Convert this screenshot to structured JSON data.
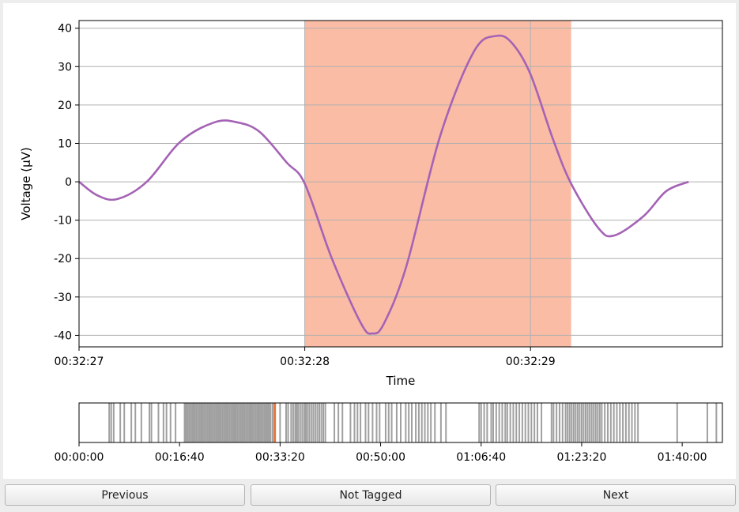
{
  "buttons": {
    "previous": "Previous",
    "tag_status": "Not Tagged",
    "next": "Next"
  },
  "chart_data": [
    {
      "type": "line",
      "xlabel": "Time",
      "ylabel": "Voltage (μV)",
      "xlim": [
        0,
        2.85
      ],
      "ylim": [
        -43,
        42
      ],
      "x_ticks": [
        {
          "value": 0.0,
          "label": "00:32:27"
        },
        {
          "value": 1.0,
          "label": "00:32:28"
        },
        {
          "value": 2.0,
          "label": "00:32:29"
        }
      ],
      "y_ticks": [
        40,
        30,
        20,
        10,
        0,
        -10,
        -20,
        -30,
        -40
      ],
      "grid": true,
      "line_color": "#a463b5",
      "highlight": {
        "x_start": 1.0,
        "x_end": 2.18,
        "color": "#fbbca5"
      },
      "series": [
        {
          "x": [
            0.0,
            0.08,
            0.17,
            0.3,
            0.45,
            0.6,
            0.7,
            0.8,
            0.92,
            1.0,
            1.12,
            1.25,
            1.3,
            1.35,
            1.45,
            1.6,
            1.75,
            1.85,
            1.92,
            2.0,
            2.1,
            2.18,
            2.3,
            2.37,
            2.5,
            2.6,
            2.7
          ],
          "y": [
            0,
            -3.5,
            -4.5,
            0,
            10.5,
            15.5,
            15.5,
            13,
            5,
            -0.5,
            -20,
            -37,
            -39.5,
            -37,
            -22,
            12,
            34,
            38,
            36,
            28,
            11,
            -0.5,
            -12,
            -14,
            -9,
            -2.5,
            0
          ]
        }
      ]
    },
    {
      "type": "event-raster",
      "xlim": [
        0,
        6400
      ],
      "x_ticks": [
        {
          "value": 0,
          "label": "00:00:00"
        },
        {
          "value": 1000,
          "label": "00:16:40"
        },
        {
          "value": 2000,
          "label": "00:33:20"
        },
        {
          "value": 3000,
          "label": "00:50:00"
        },
        {
          "value": 4000,
          "label": "01:06:40"
        },
        {
          "value": 5000,
          "label": "01:23:20"
        },
        {
          "value": 6000,
          "label": "01:40:00"
        }
      ],
      "event_color": "#a0a0a0",
      "current_color": "#e8743b",
      "current_event": 1947,
      "events": [
        300,
        320,
        345,
        410,
        450,
        520,
        560,
        620,
        700,
        720,
        790,
        840,
        870,
        910,
        960,
        1050,
        1065,
        1080,
        1095,
        1110,
        1125,
        1140,
        1155,
        1170,
        1185,
        1200,
        1215,
        1230,
        1245,
        1260,
        1275,
        1290,
        1305,
        1320,
        1335,
        1350,
        1365,
        1380,
        1395,
        1410,
        1425,
        1440,
        1455,
        1470,
        1485,
        1500,
        1515,
        1530,
        1545,
        1560,
        1575,
        1590,
        1605,
        1620,
        1635,
        1650,
        1665,
        1680,
        1695,
        1710,
        1725,
        1740,
        1755,
        1770,
        1785,
        1800,
        1815,
        1830,
        1845,
        1860,
        1875,
        1890,
        1905,
        1925,
        2000,
        2060,
        2080,
        2110,
        2130,
        2150,
        2165,
        2180,
        2200,
        2220,
        2240,
        2255,
        2270,
        2290,
        2310,
        2330,
        2350,
        2370,
        2390,
        2410,
        2430,
        2450,
        2540,
        2580,
        2620,
        2700,
        2740,
        2770,
        2800,
        2850,
        2880,
        2920,
        2960,
        2990,
        3050,
        3080,
        3110,
        3160,
        3200,
        3250,
        3280,
        3310,
        3350,
        3380,
        3410,
        3440,
        3470,
        3500,
        3540,
        3600,
        3650,
        3980,
        4000,
        4030,
        4060,
        4100,
        4120,
        4150,
        4180,
        4210,
        4240,
        4260,
        4290,
        4320,
        4350,
        4380,
        4410,
        4440,
        4470,
        4500,
        4530,
        4560,
        4600,
        4700,
        4720,
        4750,
        4780,
        4810,
        4840,
        4860,
        4880,
        4900,
        4920,
        4940,
        4960,
        4980,
        5000,
        5020,
        5040,
        5060,
        5080,
        5100,
        5120,
        5140,
        5160,
        5180,
        5200,
        5230,
        5260,
        5290,
        5320,
        5350,
        5380,
        5410,
        5440,
        5470,
        5500,
        5530,
        5560,
        5950,
        6250,
        6340
      ]
    }
  ]
}
